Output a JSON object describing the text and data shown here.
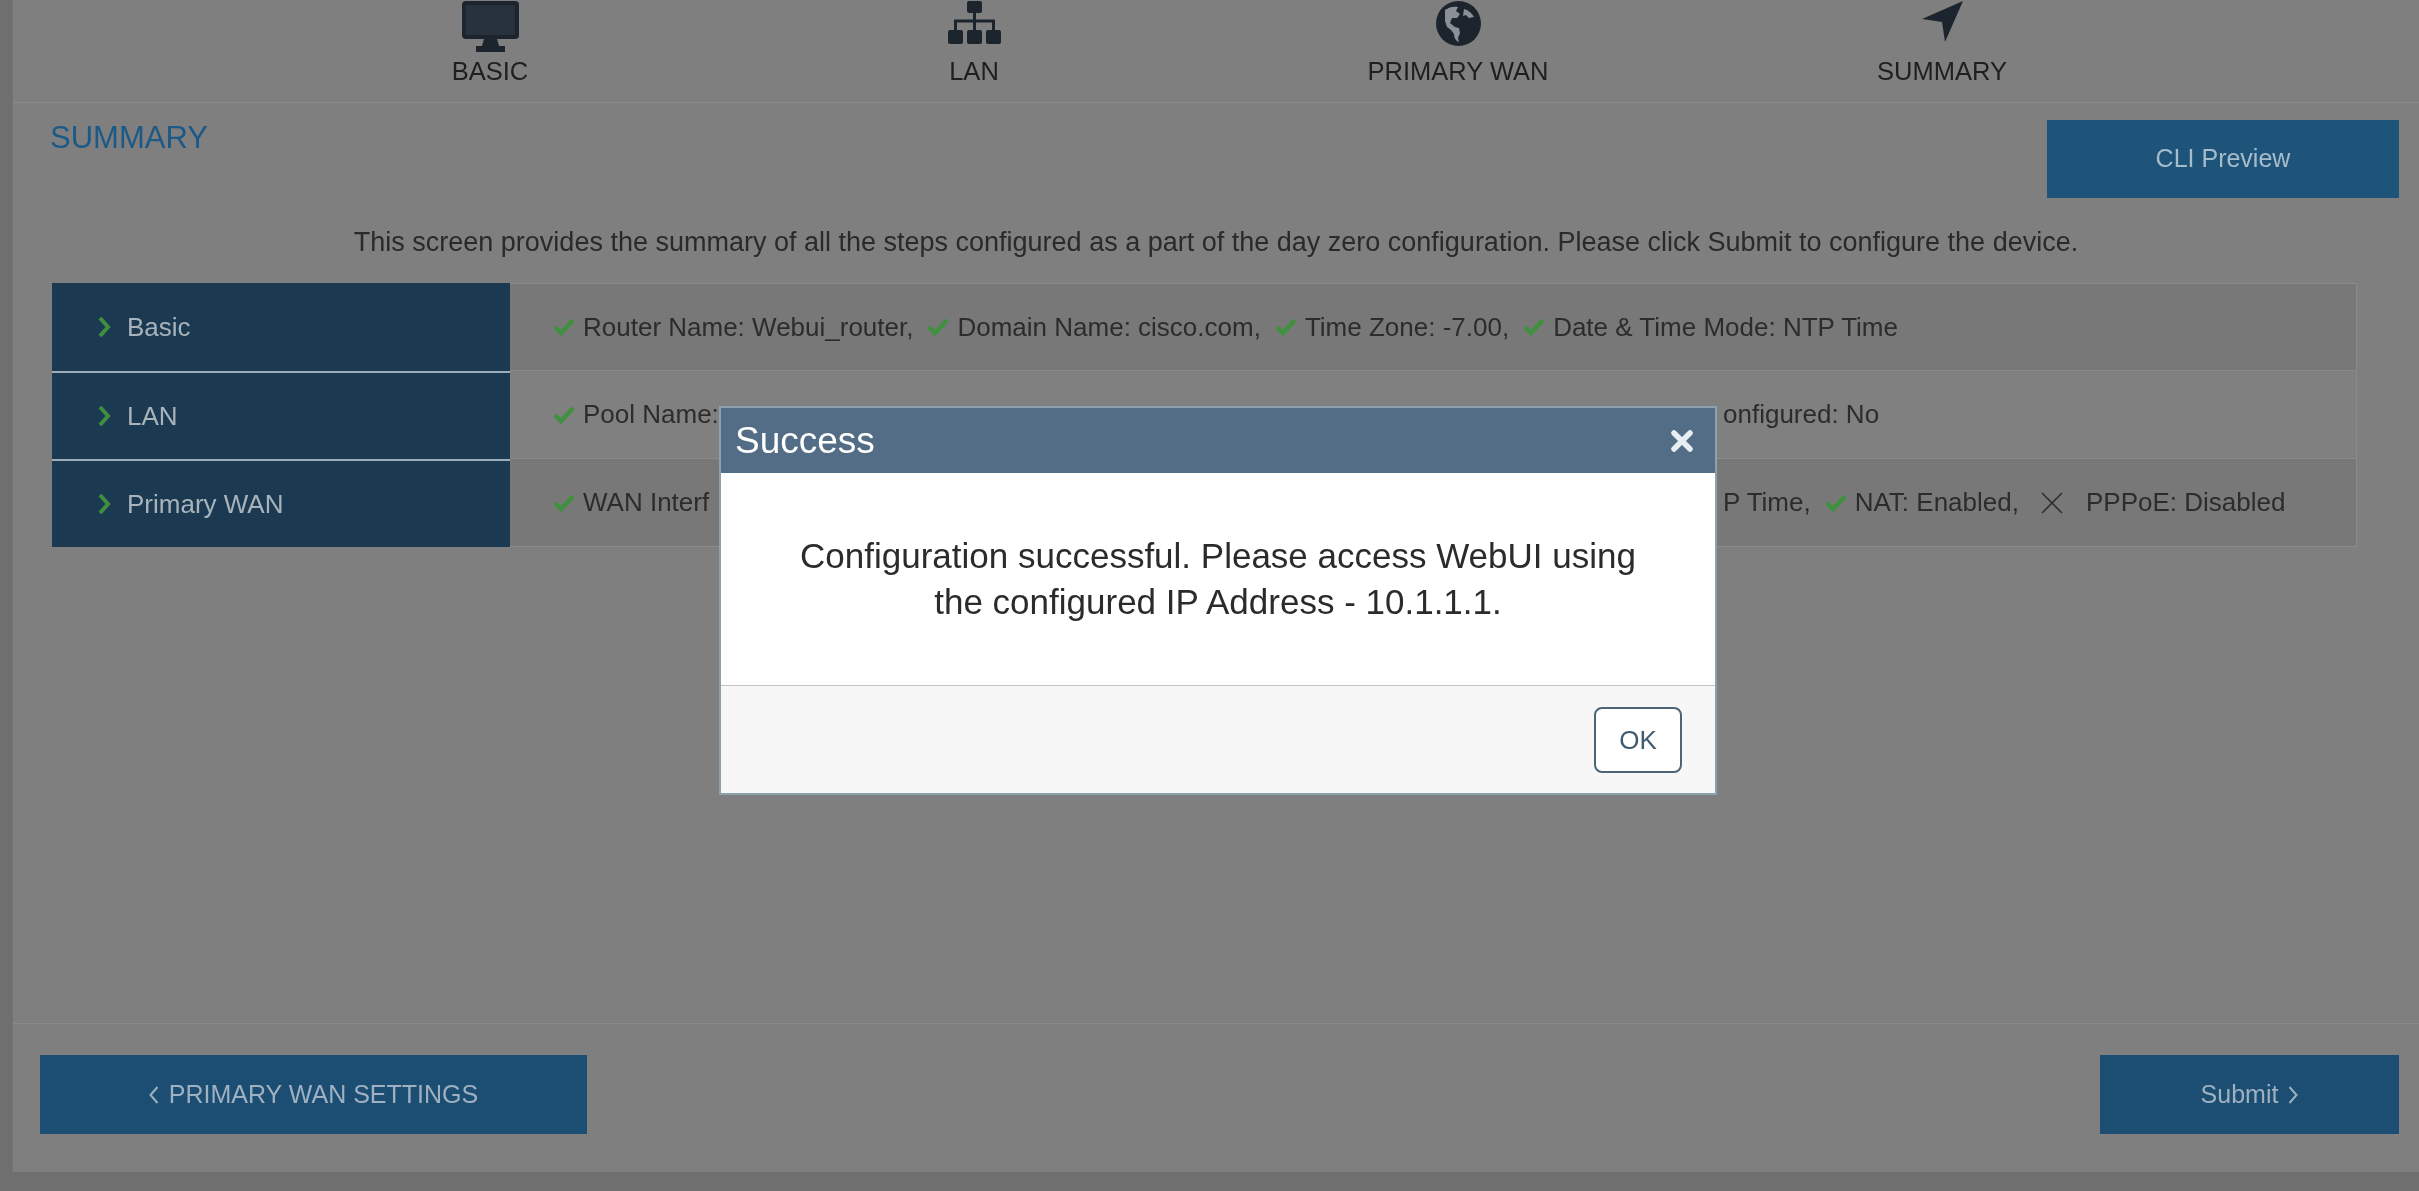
{
  "steps": [
    {
      "label": "BASIC"
    },
    {
      "label": "LAN"
    },
    {
      "label": "PRIMARY WAN"
    },
    {
      "label": "SUMMARY"
    }
  ],
  "summary": {
    "heading": "SUMMARY",
    "cli_preview_button": "CLI Preview",
    "description": "This screen provides the summary of all the steps configured as a part of the day zero configuration. Please click Submit to configure the device."
  },
  "sections": [
    {
      "label": "Basic",
      "expanded": false,
      "segments": [
        [
          {
            "ok": true,
            "text": "Router Name: Webui_router,"
          },
          {
            "ok": true,
            "text": "Domain Name: cisco.com,"
          },
          {
            "ok": true,
            "text": "Time Zone: -7.00,"
          },
          {
            "ok": true,
            "text": "Date & Time Mode: NTP Time"
          }
        ]
      ]
    },
    {
      "label": "LAN",
      "expanded": false,
      "segments": [
        [
          {
            "ok": true,
            "text": "Pool Name:"
          }
        ],
        [
          {
            "text": "onfigured: No"
          }
        ]
      ]
    },
    {
      "label": "Primary WAN",
      "expanded": false,
      "segments": [
        [
          {
            "ok": true,
            "text": "WAN Interf"
          }
        ],
        [
          {
            "text": "P Time,"
          },
          {
            "ok": true,
            "text": "NAT: Enabled,"
          },
          {
            "ok": false,
            "text": "PPPoE: Disabled"
          }
        ]
      ]
    }
  ],
  "nav_buttons": {
    "back": "PRIMARY WAN SETTINGS",
    "submit": "Submit"
  },
  "dialog": {
    "title": "Success",
    "message": "Configuration successful. Please access WebUI using the configured IP Address - 10.1.1.1.",
    "ok_button": "OK"
  }
}
